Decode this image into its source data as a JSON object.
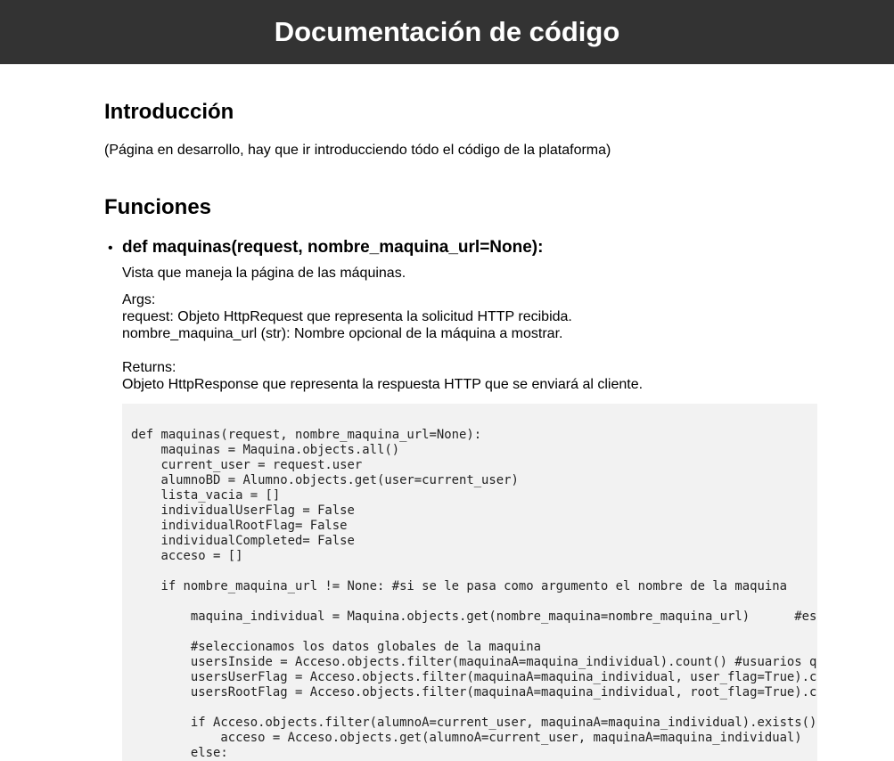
{
  "header": {
    "title": "Documentación de código"
  },
  "intro": {
    "heading": "Introducción",
    "text": "(Página en desarrollo, hay que ir introducciendo tódo el código de la plataforma)"
  },
  "functions": {
    "heading": "Funciones",
    "items": [
      {
        "signature": "def maquinas(request, nombre_maquina_url=None):",
        "description": "Vista que maneja la página de las máquinas.",
        "args_label": "Args:",
        "args": [
          "request: Objeto HttpRequest que representa la solicitud HTTP recibida.",
          "nombre_maquina_url (str): Nombre opcional de la máquina a mostrar."
        ],
        "returns_label": "Returns:",
        "returns": "Objeto HttpResponse que representa la respuesta HTTP que se enviará al cliente.",
        "code": "def maquinas(request, nombre_maquina_url=None):\n    maquinas = Maquina.objects.all()\n    current_user = request.user\n    alumnoBD = Alumno.objects.get(user=current_user)\n    lista_vacia = []\n    individualUserFlag = False\n    individualRootFlag= False\n    individualCompleted= False\n    acceso = []\n\n    if nombre_maquina_url != None: #si se le pasa como argumento el nombre de la maquina\n\n        maquina_individual = Maquina.objects.get(nombre_maquina=nombre_maquina_url)      #es\n\n        #seleccionamos los datos globales de la maquina\n        usersInside = Acceso.objects.filter(maquinaA=maquina_individual).count() #usuarios q\n        usersUserFlag = Acceso.objects.filter(maquinaA=maquina_individual, user_flag=True).c\n        usersRootFlag = Acceso.objects.filter(maquinaA=maquina_individual, root_flag=True).c\n\n        if Acceso.objects.filter(alumnoA=current_user, maquinaA=maquina_individual).exists()\n            acceso = Acceso.objects.get(alumnoA=current_user, maquinaA=maquina_individual)\n        else:"
      }
    ]
  }
}
